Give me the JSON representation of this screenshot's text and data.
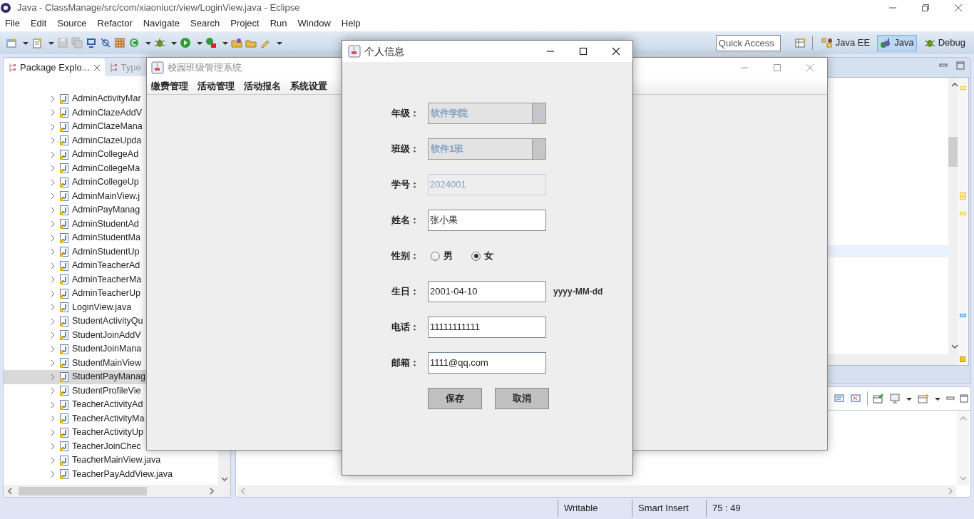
{
  "window": {
    "title": "Java - ClassManage/src/com/xiaoniucr/view/LoginView.java - Eclipse"
  },
  "menu": [
    "File",
    "Edit",
    "Source",
    "Refactor",
    "Navigate",
    "Search",
    "Project",
    "Run",
    "Window",
    "Help"
  ],
  "quick_access": {
    "placeholder": "Quick Access"
  },
  "perspectives": [
    {
      "label": "Java EE",
      "selected": false
    },
    {
      "label": "Java",
      "selected": true
    },
    {
      "label": "Debug",
      "selected": false
    }
  ],
  "explorer": {
    "tabs": [
      {
        "label": "Package Explo...",
        "selected": true
      },
      {
        "label": "Type",
        "selected": false
      }
    ],
    "items": [
      {
        "label": "AdminActivityMar",
        "selected": false
      },
      {
        "label": "AdminClazeAddV",
        "selected": false
      },
      {
        "label": "AdminClazeMana",
        "selected": false
      },
      {
        "label": "AdminClazeUpda",
        "selected": false
      },
      {
        "label": "AdminCollegeAd",
        "selected": false
      },
      {
        "label": "AdminCollegeMa",
        "selected": false
      },
      {
        "label": "AdminCollegeUp",
        "selected": false
      },
      {
        "label": "AdminMainView.j",
        "selected": false
      },
      {
        "label": "AdminPayManag",
        "selected": false
      },
      {
        "label": "AdminStudentAd",
        "selected": false
      },
      {
        "label": "AdminStudentMa",
        "selected": false
      },
      {
        "label": "AdminStudentUp",
        "selected": false
      },
      {
        "label": "AdminTeacherAd",
        "selected": false
      },
      {
        "label": "AdminTeacherMa",
        "selected": false
      },
      {
        "label": "AdminTeacherUp",
        "selected": false
      },
      {
        "label": "LoginView.java",
        "selected": false
      },
      {
        "label": "StudentActivityQu",
        "selected": false
      },
      {
        "label": "StudentJoinAddV",
        "selected": false
      },
      {
        "label": "StudentJoinMana",
        "selected": false
      },
      {
        "label": "StudentMainView",
        "selected": false
      },
      {
        "label": "StudentPayManag",
        "selected": true
      },
      {
        "label": "StudentProfileVie",
        "selected": false
      },
      {
        "label": "TeacherActivityAd",
        "selected": false
      },
      {
        "label": "TeacherActivityMa",
        "selected": false
      },
      {
        "label": "TeacherActivityUp",
        "selected": false
      },
      {
        "label": "TeacherJoinChec",
        "selected": false
      },
      {
        "label": "TeacherMainView.java",
        "selected": false
      },
      {
        "label": "TeacherPayAddView.java",
        "selected": false
      }
    ]
  },
  "app_window": {
    "title": "校园班级管理系统",
    "menus": [
      "缴费管理",
      "活动管理",
      "活动报名",
      "系统设置"
    ]
  },
  "dialog": {
    "title": "个人信息",
    "fields": [
      {
        "kind": "combo",
        "label": "年级：",
        "value": "软件学院",
        "disabled": true
      },
      {
        "kind": "combo",
        "label": "班级：",
        "value": "软件1班",
        "disabled": true
      },
      {
        "kind": "text",
        "label": "学号：",
        "value": "2024001",
        "disabled": true
      },
      {
        "kind": "text",
        "label": "姓名：",
        "value": "张小果",
        "disabled": false
      },
      {
        "kind": "radio",
        "label": "性别：",
        "options": [
          {
            "label": "男",
            "selected": false
          },
          {
            "label": "女",
            "selected": true
          }
        ]
      },
      {
        "kind": "text",
        "label": "生日：",
        "value": "2001-04-10",
        "disabled": false,
        "hint": "yyyy-MM-dd"
      },
      {
        "kind": "text",
        "label": "电话：",
        "value": "11111111111",
        "disabled": false
      },
      {
        "kind": "text",
        "label": "邮箱：",
        "value": "1111@qq.com",
        "disabled": false
      }
    ],
    "buttons": [
      "保存",
      "取消"
    ]
  },
  "status_bar": [
    "Writable",
    "Smart Insert",
    "75 : 49"
  ]
}
